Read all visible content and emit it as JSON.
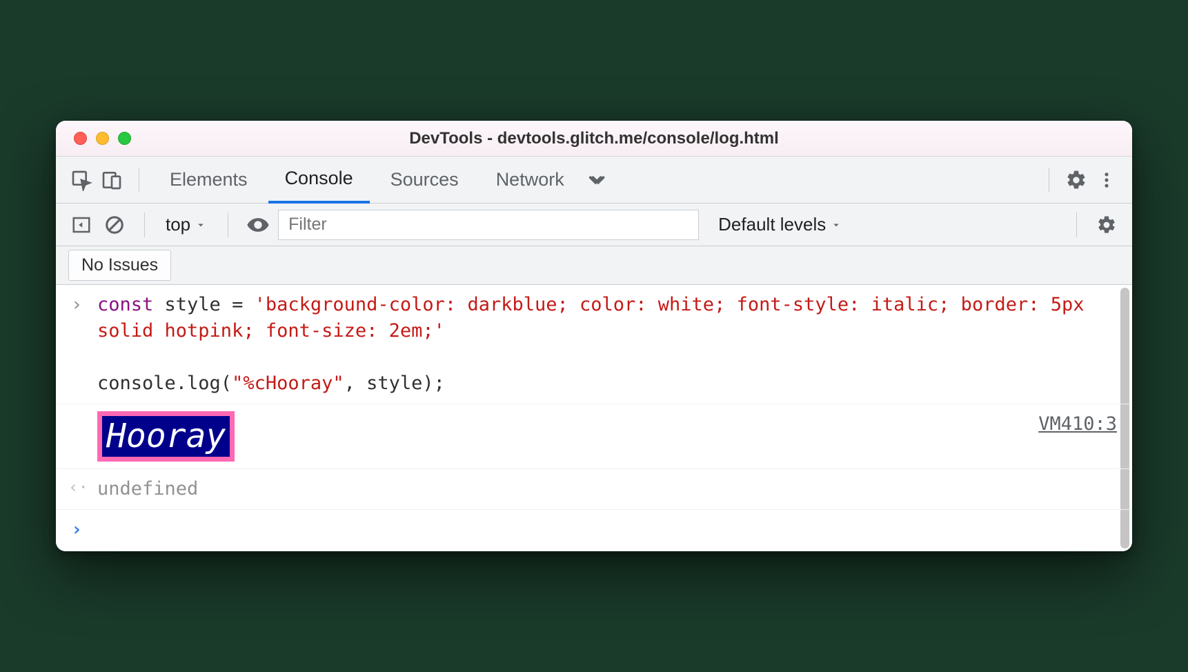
{
  "window": {
    "title": "DevTools - devtools.glitch.me/console/log.html"
  },
  "tabs": {
    "elements": "Elements",
    "console": "Console",
    "sources": "Sources",
    "network": "Network"
  },
  "subbar": {
    "context": "top",
    "filter_placeholder": "Filter",
    "levels": "Default levels"
  },
  "issues": {
    "button": "No Issues"
  },
  "entry": {
    "code_kw": "const",
    "code_line1_rest": " style = ",
    "code_str": "'background-color: darkblue; color: white; font-style: italic; border: 5px solid hotpink; font-size: 2em;'",
    "code_line2": "console.log(",
    "code_line2_str": "\"%cHooray\"",
    "code_line2_rest": ", style);"
  },
  "output": {
    "styled_text": "Hooray",
    "source": "VM410:3",
    "return_value": "undefined"
  }
}
